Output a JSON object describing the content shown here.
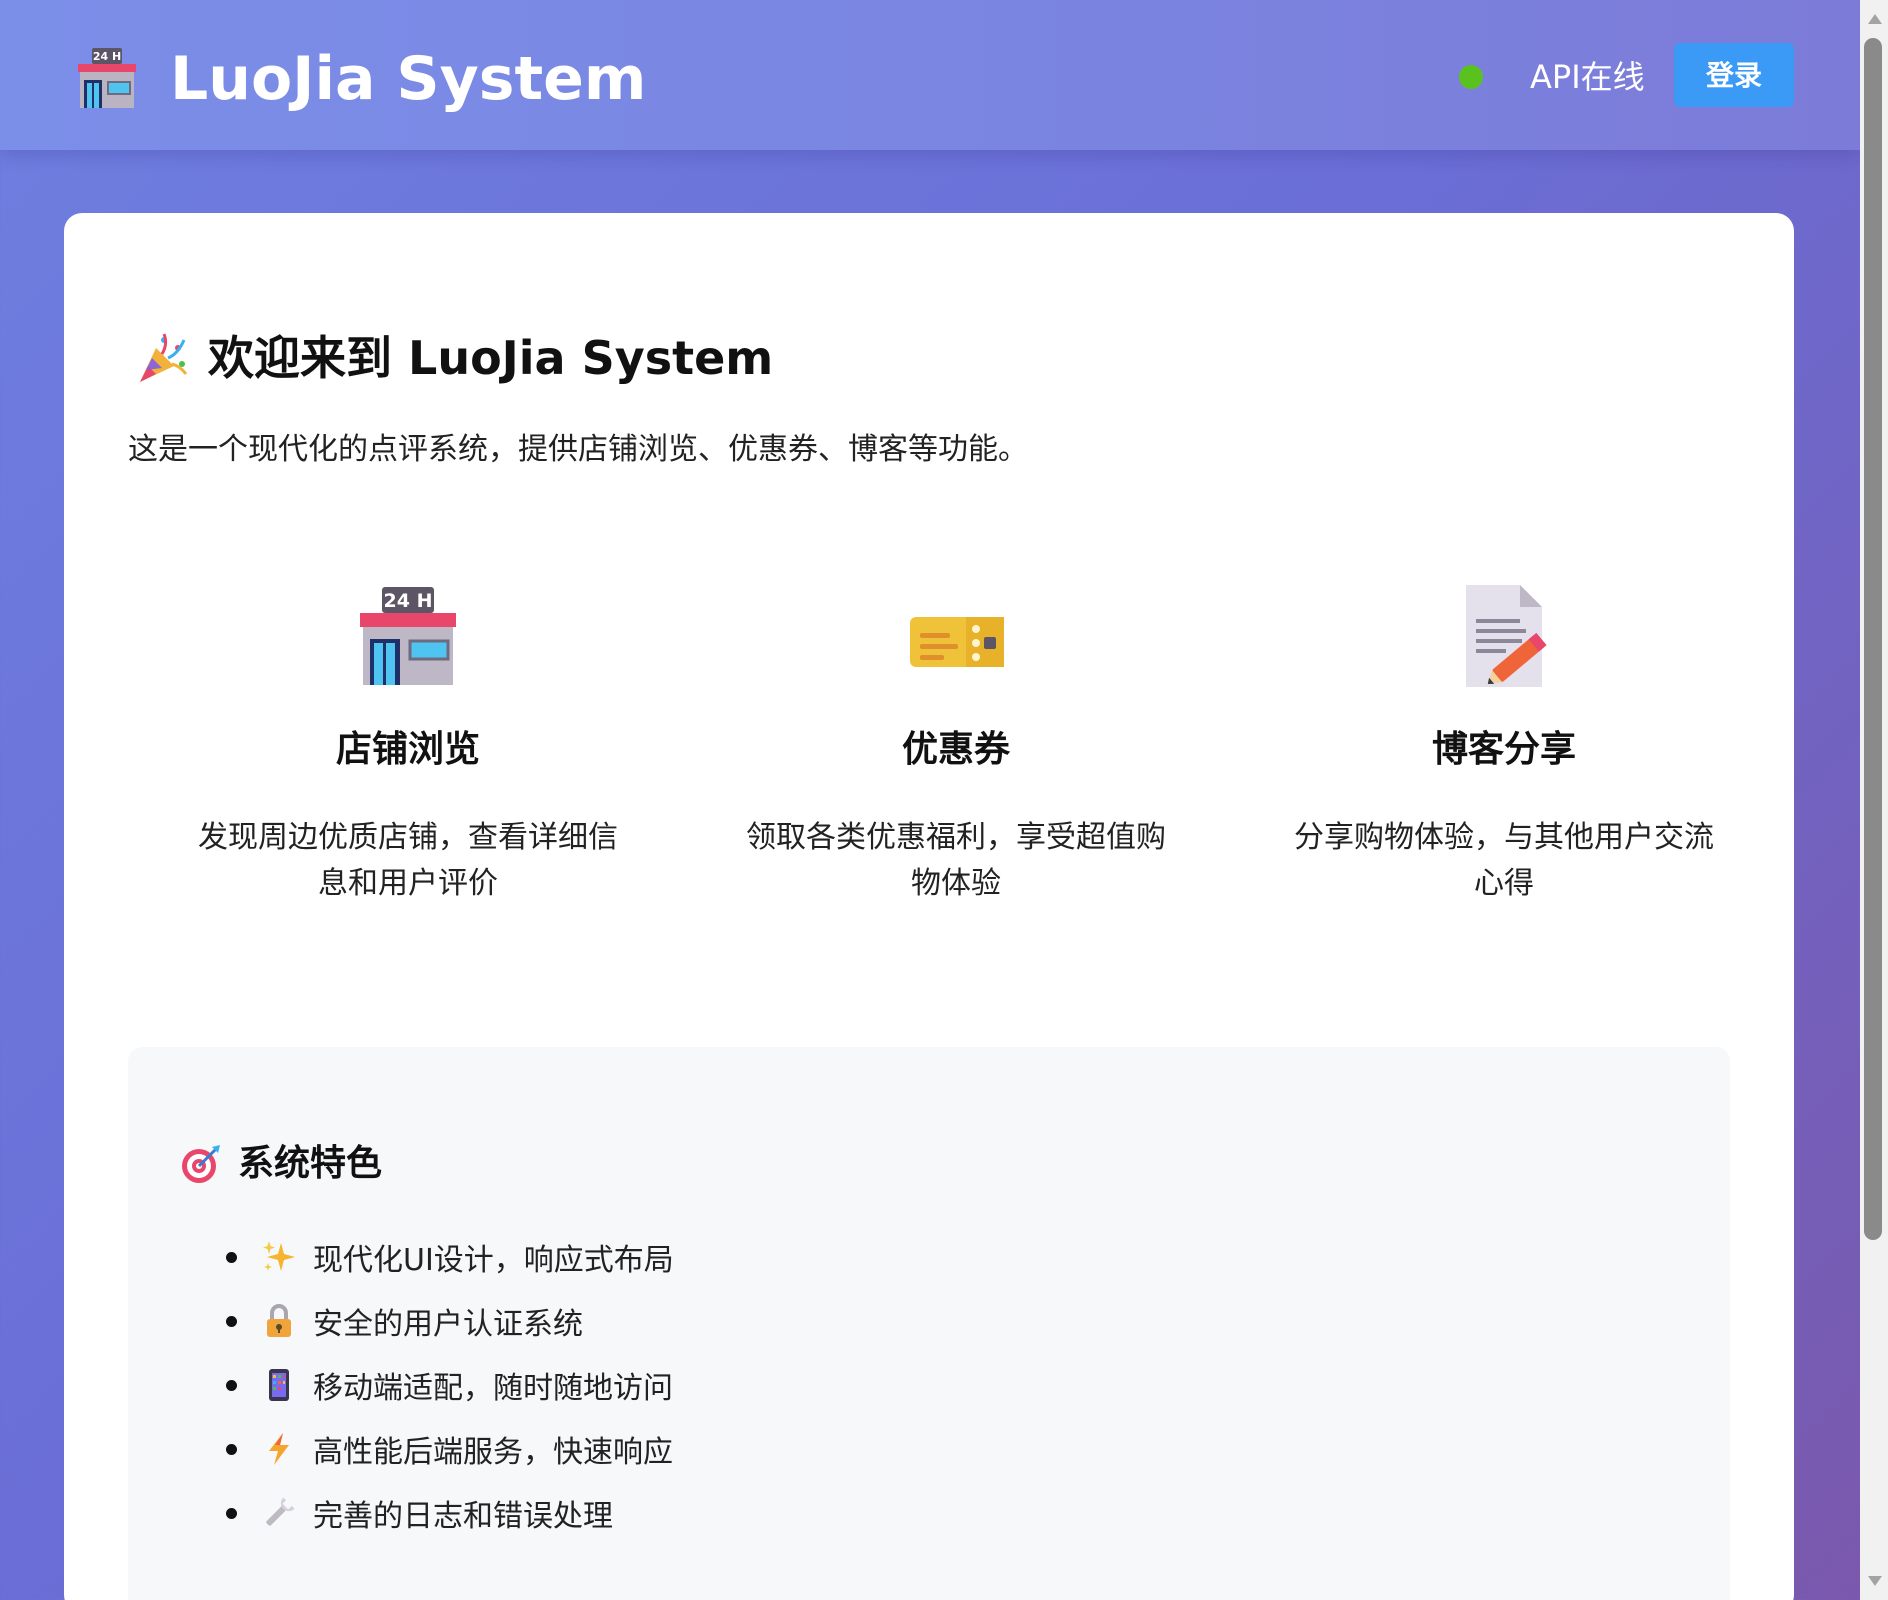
{
  "header": {
    "logo_icon": "convenience-store-icon",
    "title": "LuoJia System",
    "status_text": "API在线",
    "status_color": "#5ac21e",
    "login_label": "登录",
    "login_color": "#3b9af5"
  },
  "main": {
    "welcome_icon": "party-popper-icon",
    "welcome_title": "欢迎来到 LuoJia System",
    "intro": "这是一个现代化的点评系统，提供店铺浏览、优惠券、博客等功能。",
    "features": [
      {
        "icon": "convenience-store-icon",
        "title": "店铺浏览",
        "description": "发现周边优质店铺，查看详细信息和用户评价"
      },
      {
        "icon": "ticket-icon",
        "title": "优惠券",
        "description": "领取各类优惠福利，享受超值购物体验"
      },
      {
        "icon": "memo-icon",
        "title": "博客分享",
        "description": "分享购物体验，与其他用户交流心得"
      }
    ],
    "highlights": {
      "icon": "target-icon",
      "title": "系统特色",
      "items": [
        {
          "icon": "sparkles-icon",
          "text": "现代化UI设计，响应式布局"
        },
        {
          "icon": "lock-icon",
          "text": "安全的用户认证系统"
        },
        {
          "icon": "phone-icon",
          "text": "移动端适配，随时随地访问"
        },
        {
          "icon": "lightning-icon",
          "text": "高性能后端服务，快速响应"
        },
        {
          "icon": "wrench-icon",
          "text": "完善的日志和错误处理"
        }
      ]
    }
  }
}
